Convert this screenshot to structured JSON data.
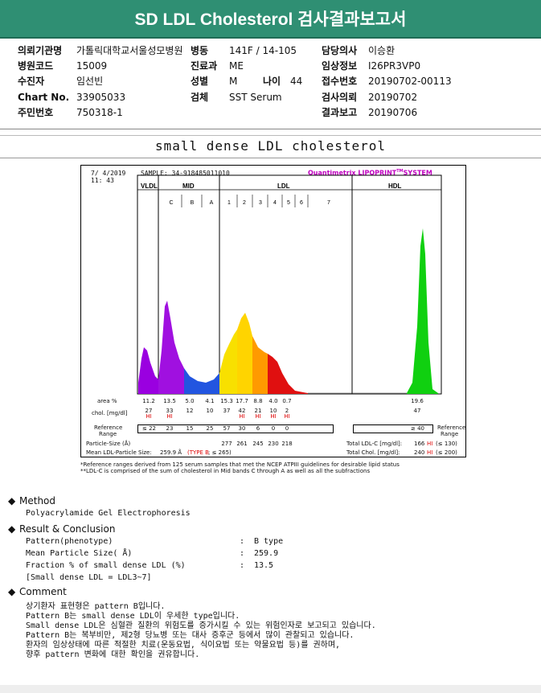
{
  "header": {
    "title": "SD LDL Cholesterol 검사결과보고서"
  },
  "info": {
    "rows": [
      [
        {
          "label": "의뢰기관명",
          "value": "가톨릭대학교서울성모병원"
        },
        {
          "label": "병동",
          "value": "141F / 14-105"
        },
        {
          "label": "담당의사",
          "value": "이승환"
        }
      ],
      [
        {
          "label": "병원코드",
          "value": "15009"
        },
        {
          "label": "진료과",
          "value": "ME"
        },
        {
          "label": "임상정보",
          "value": "I26PR3VP0"
        }
      ],
      [
        {
          "label": "수진자",
          "value": "임선빈"
        },
        {
          "label": "성별",
          "value": "M"
        },
        {
          "label": "접수번호",
          "value": "20190702-00113"
        }
      ],
      [
        {
          "label": "Chart No.",
          "value": "33905033"
        },
        {
          "label": "검체",
          "value": "SST Serum"
        },
        {
          "label": "검사의뢰",
          "value": "20190702"
        }
      ],
      [
        {
          "label": "주민번호",
          "value": "750318-1"
        },
        {
          "label": "",
          "value": ""
        },
        {
          "label": "결과보고",
          "value": "20190706"
        }
      ]
    ],
    "age_label": "나이",
    "age_value": "44"
  },
  "section_title": "small dense LDL cholesterol",
  "chart": {
    "date": "7/ 4/2019",
    "time": "11: 43",
    "sample": "SAMPLE:   34-918485011010",
    "brand": "Quantimetrix LIPOPRINT",
    "brand_tm": "TM",
    "brand_suffix": "SYSTEM",
    "fractions": [
      "C",
      "B",
      "A",
      "1",
      "2",
      "3",
      "4",
      "5",
      "6",
      "7"
    ],
    "group_labels": {
      "vldl": "VLDL",
      "mid": "MID",
      "ldl": "LDL",
      "hdl": "HDL"
    },
    "row_labels": {
      "area": "area %",
      "chol": "chol. [mg/dl]",
      "ref": "Reference",
      "range": "Range",
      "particle": "Particle-Size (Å)",
      "mean": "Mean LDL-Particle Size:"
    },
    "area": [
      "11.2",
      "13.5",
      "5.0",
      "4.1",
      "15.3",
      "17.7",
      "8.8",
      "4.0",
      "0.7",
      "",
      "19.6"
    ],
    "chol": [
      "27",
      "33",
      "12",
      "10",
      "37",
      "42",
      "21",
      "10",
      "2",
      "",
      "47"
    ],
    "chol_flags": [
      "HI",
      "HI",
      "",
      "",
      "",
      "HI",
      "HI",
      "HI",
      "HI",
      "",
      ""
    ],
    "ref": [
      "≤ 22",
      "23",
      "15",
      "25",
      "57",
      "30",
      "6",
      "0",
      "0",
      "",
      "≥ 40"
    ],
    "particle": [
      "277",
      "261",
      "245",
      "230",
      "218"
    ],
    "mean_value": "259.9 Å",
    "mean_type": "(TYPE B",
    "mean_limit": "; ≤ 265)",
    "total_ldl_label": "Total LDL-C [mg/dl]:",
    "total_ldl_value": "166",
    "total_ldl_flag": "HI",
    "total_ldl_ref": "(≤ 130)",
    "total_chol_label": "Total Chol. [mg/dl]:",
    "total_chol_value": "240",
    "total_chol_flag": "HI",
    "total_chol_ref": "(≤ 200)"
  },
  "chart_data": {
    "type": "area",
    "x": [
      "VLDL",
      "C",
      "B",
      "A",
      "1",
      "2",
      "3",
      "4",
      "5",
      "6",
      "7",
      "HDL"
    ],
    "area_percent": [
      11.2,
      13.5,
      5.0,
      4.1,
      15.3,
      17.7,
      8.8,
      4.0,
      0.7,
      0,
      0,
      19.6
    ],
    "chol_mg_dl": [
      27,
      33,
      12,
      10,
      37,
      42,
      21,
      10,
      2,
      0,
      0,
      47
    ],
    "reference": [
      "≤ 22",
      "23",
      "15",
      "25",
      "57",
      "30",
      "6",
      "0",
      "0",
      "",
      "",
      "≥ 40"
    ],
    "particle_size_A": {
      "1": 277,
      "2": 261,
      "3": 245,
      "4": 230,
      "5": 218
    },
    "colors": {
      "vldl": "#9a00e0",
      "mid": "#2255e0",
      "ldl1": "#ffd400",
      "ldl2": "#ff9a00",
      "ldl3": "#e01010",
      "hdl": "#10d010"
    }
  },
  "footnotes": [
    "*Reference ranges derived from 125 serum samples that met the NCEP ATPIII guidelines for desirable lipid status",
    "**LDL-C is comprised of the sum of cholesterol in Mid bands C through A as well as all the subfractions"
  ],
  "method": {
    "title": "Method",
    "text": "Polyacrylamide Gel Electrophoresis"
  },
  "result": {
    "title": "Result & Conclusion",
    "rows": [
      {
        "label": "Pattern(phenotype)",
        "value": "B type"
      },
      {
        "label": "Mean Particle Size( Å)",
        "value": "259.9"
      },
      {
        "label": "Fraction % of small dense LDL (%)",
        "value": "13.5"
      }
    ],
    "note": "[Small dense LDL = LDL3~7]"
  },
  "comment": {
    "title": "Comment",
    "lines": [
      "상기환자 표현형은 pattern B입니다.",
      "Pattern B는 small dense LDL이 우세한 type입니다.",
      "Small dense LDL은 심혈관 질환의 위험도를 증가시킬 수 있는 위험인자로 보고되고 있습니다.",
      "Pattern B는 복부비만, 제2형 당뇨병 또는 대사 증후군 등에서 많이 관찰되고 있습니다.",
      "환자의 임상상태에 따른 적절한 치료(운동요법, 식이요법 또는 약물요법 등)를 권하며,",
      "향후 pattern 변화에 대한 확인을 권유합니다."
    ]
  }
}
